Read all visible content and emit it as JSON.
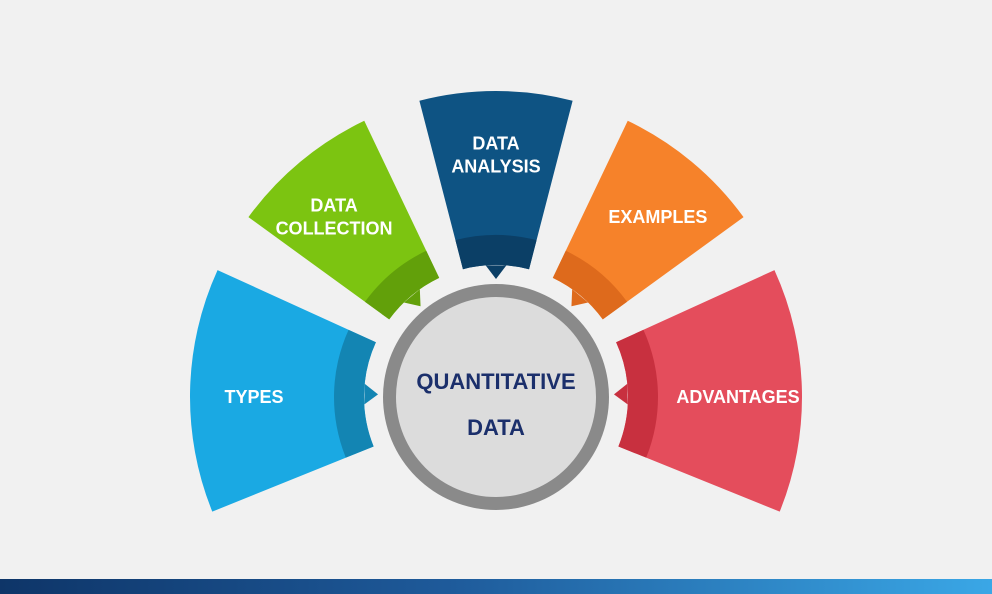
{
  "center": {
    "line1": "QUANTITATIVE",
    "line2": "DATA"
  },
  "segments": [
    {
      "id": "types",
      "lines": [
        "TYPES"
      ],
      "color": "#1aa9e3",
      "inner": "#1385b3"
    },
    {
      "id": "data-collection",
      "lines": [
        "DATA",
        "COLLECTION"
      ],
      "color": "#7cc411",
      "inner": "#62a00a"
    },
    {
      "id": "data-analysis",
      "lines": [
        "DATA",
        "ANALYSIS"
      ],
      "color": "#0e5383",
      "inner": "#0b3f66"
    },
    {
      "id": "examples",
      "lines": [
        "EXAMPLES"
      ],
      "color": "#f6822a",
      "inner": "#de6a1c"
    },
    {
      "id": "advantages",
      "lines": [
        "ADVANTAGES"
      ],
      "color": "#e44d5c",
      "inner": "#c8303f"
    }
  ],
  "colors": {
    "background": "#f1f1f1",
    "center_fill": "#dcdcdc",
    "center_ring": "#8a8a8a",
    "center_text": "#1b2f6b"
  }
}
